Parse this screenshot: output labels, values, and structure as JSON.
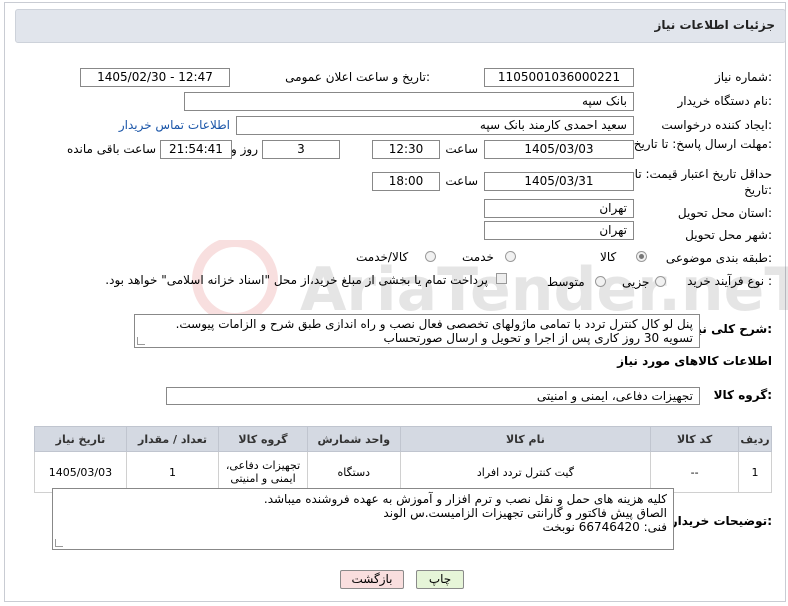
{
  "header": {
    "title": "جزئیات اطلاعات نیاز"
  },
  "fields": {
    "need_number_label": "شماره نیاز:",
    "need_number": "1105001036000221",
    "announce_label": "تاریخ و ساعت اعلان عمومی:",
    "announce_value": "1405/02/30 - 12:47",
    "buyer_org_label": "نام دستگاه خریدار:",
    "buyer_org": "بانک سپه",
    "creator_label": "ایجاد کننده درخواست:",
    "creator": "سعید احمدی کارمند بانک سپه",
    "buyer_contact_link": "اطلاعات تماس خریدار",
    "reply_deadline_label": "مهلت ارسال پاسخ: تا تاریخ:",
    "reply_date": "1405/03/03",
    "time_label": "ساعت",
    "reply_time": "12:30",
    "days_value": "3",
    "days_label": "روز و",
    "remaining_time": "21:54:41",
    "remaining_label": "ساعت باقی مانده",
    "price_validity_label": "حداقل تاریخ اعتبار قیمت: تا تاریخ:",
    "price_date": "1405/03/31",
    "time_label2": "ساعت",
    "price_time": "18:00",
    "province_label": "استان محل تحویل:",
    "province": "تهران",
    "city_label": "شهر محل تحویل:",
    "city": "تهران",
    "category_label": "طبقه بندی موضوعی:",
    "category_options": [
      "کالا",
      "خدمت",
      "کالا/خدمت"
    ],
    "purchase_type_label": "نوع فرآیند خرید :",
    "purchase_options": [
      "جزیی",
      "متوسط"
    ],
    "purchase_note": "پرداخت تمام یا بخشی از مبلغ خرید،از محل \"اسناد خزانه اسلامی\" خواهد بود.",
    "description_label": "شرح کلی نیاز:",
    "description_lines": [
      "پنل لو کال کنترل تردد با تمامی ماژولهای تخصصی فعال نصب و راه اندازی طبق شرح و الزامات پیوست.",
      "تسویه 30 روز کاری پس از اجرا و تحویل و ارسال صورتحساب"
    ]
  },
  "goods": {
    "section_title": "اطلاعات کالاهای مورد نیاز",
    "group_label": "گروه کالا:",
    "group_value": "تجهیزات دفاعی، ایمنی و امنیتی",
    "columns": [
      "ردیف",
      "کد کالا",
      "نام کالا",
      "واحد شمارش",
      "گروه کالا",
      "تعداد / مقدار",
      "تاریخ نیاز"
    ],
    "rows": [
      {
        "row": "1",
        "code": "--",
        "name": "گیت کنترل تردد افراد",
        "unit": "دستگاه",
        "group": "تجهیزات دفاعی، ایمنی و امنیتی",
        "qty": "1",
        "date": "1405/03/03"
      }
    ]
  },
  "buyer_notes": {
    "label": "توضیحات خریدار:",
    "lines": [
      "کلیه هزینه های حمل و نقل نصب و ترم افزار و آموزش به عهده فروشنده میباشد.",
      "الصاق پیش فاکتور و گارانتی تجهیزات الزامیست.س الوند",
      "فنی: 66746420 نوبخت"
    ]
  },
  "buttons": {
    "print": "چاپ",
    "back": "بازگشت"
  },
  "watermark_text": "AriaTender.neT",
  "colors": {
    "header_bg": "#e1e5ec",
    "table_header_bg": "#d4d9e2",
    "back_button_bg": "#f9dede",
    "print_button_bg": "#e6f5d8",
    "link": "#1a55a8"
  }
}
